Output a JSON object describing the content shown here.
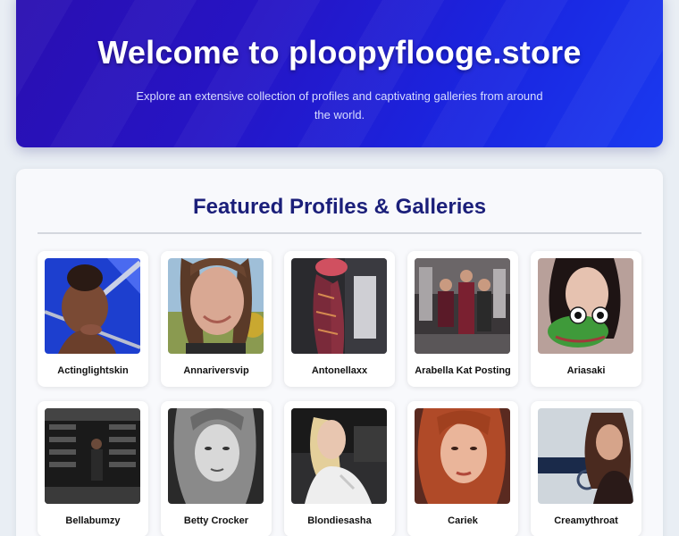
{
  "hero": {
    "title": "Welcome to ploopyflooge.store",
    "subtitle": "Explore an extensive collection of profiles and captivating galleries from around the world."
  },
  "section": {
    "title": "Featured Profiles & Galleries"
  },
  "profiles": [
    {
      "name": "Actinglightskin"
    },
    {
      "name": "Annariversvip"
    },
    {
      "name": "Antonellaxx"
    },
    {
      "name": "Arabella Kat Posting"
    },
    {
      "name": "Ariasaki"
    },
    {
      "name": "Bellabumzy"
    },
    {
      "name": "Betty Crocker"
    },
    {
      "name": "Blondiesasha"
    },
    {
      "name": "Cariek"
    },
    {
      "name": "Creamythroat"
    }
  ],
  "colors": {
    "hero_gradient_start": "#2a0fb0",
    "hero_gradient_end": "#1a3af0",
    "section_title": "#1b1f7a",
    "page_background": "#e9eef4"
  }
}
